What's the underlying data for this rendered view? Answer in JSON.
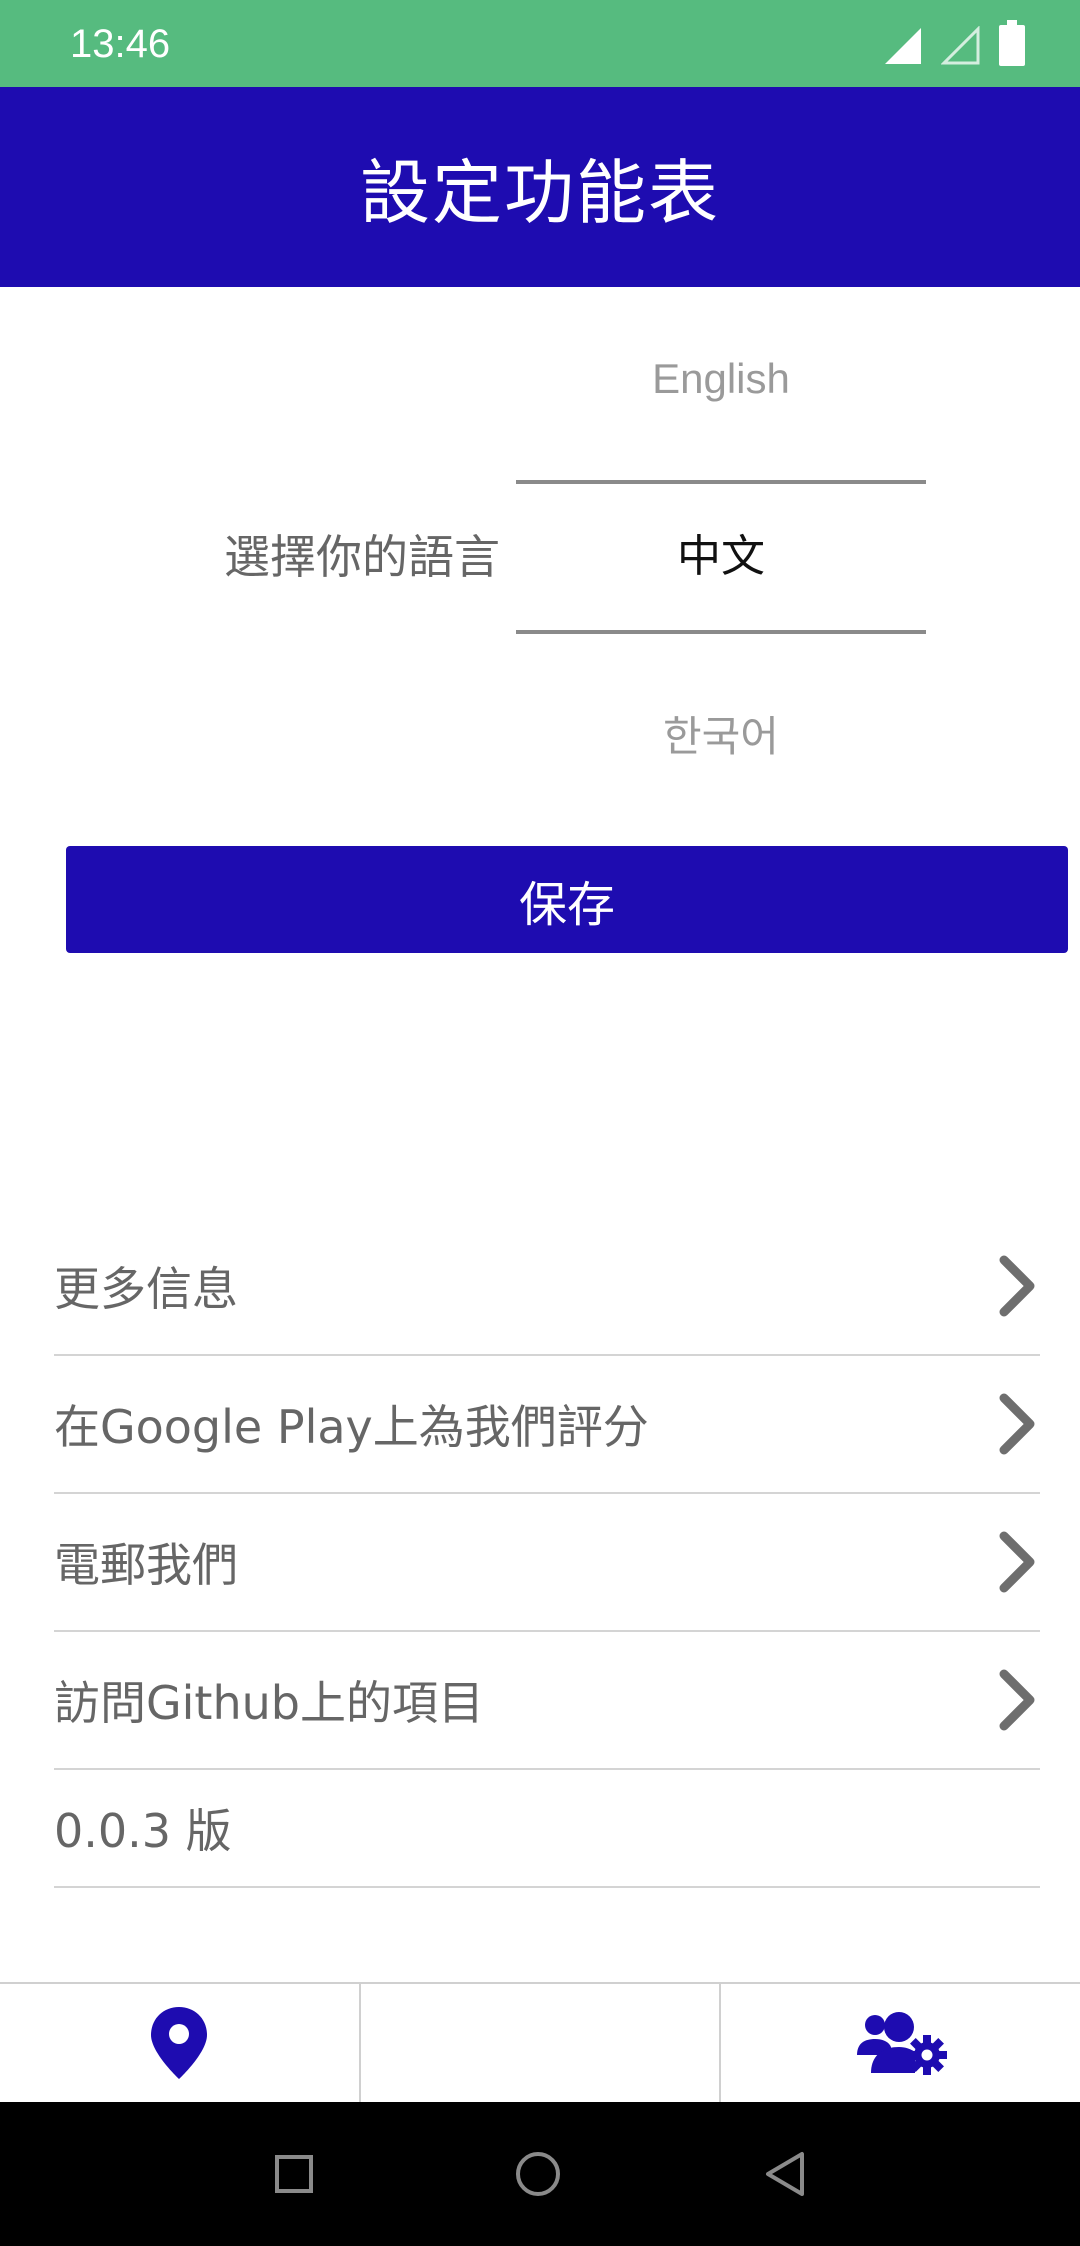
{
  "status_bar": {
    "time": "13:46",
    "icons": [
      "signal-icon",
      "signal-empty-icon",
      "battery-icon"
    ]
  },
  "app_bar": {
    "title": "設定功能表"
  },
  "language": {
    "label": "選擇你的語言",
    "options": [
      "English",
      "中文",
      "한국어"
    ],
    "selected": "中文"
  },
  "save_button": {
    "label": "保存"
  },
  "menu": {
    "items": [
      {
        "label": "更多信息",
        "has_chevron": true
      },
      {
        "label": "在Google Play上為我們評分",
        "has_chevron": true
      },
      {
        "label": "電郵我們",
        "has_chevron": true
      },
      {
        "label": "訪問Github上的項目",
        "has_chevron": true
      },
      {
        "label": "0.0.3 版",
        "has_chevron": false
      }
    ]
  },
  "bottom_nav": {
    "items": [
      "map-pin-icon",
      "",
      "users-settings-icon"
    ]
  },
  "colors": {
    "status_bar": "#56bb7f",
    "primary": "#1e0cb0",
    "text_secondary": "#666666",
    "chevron": "#6e6e6e"
  }
}
